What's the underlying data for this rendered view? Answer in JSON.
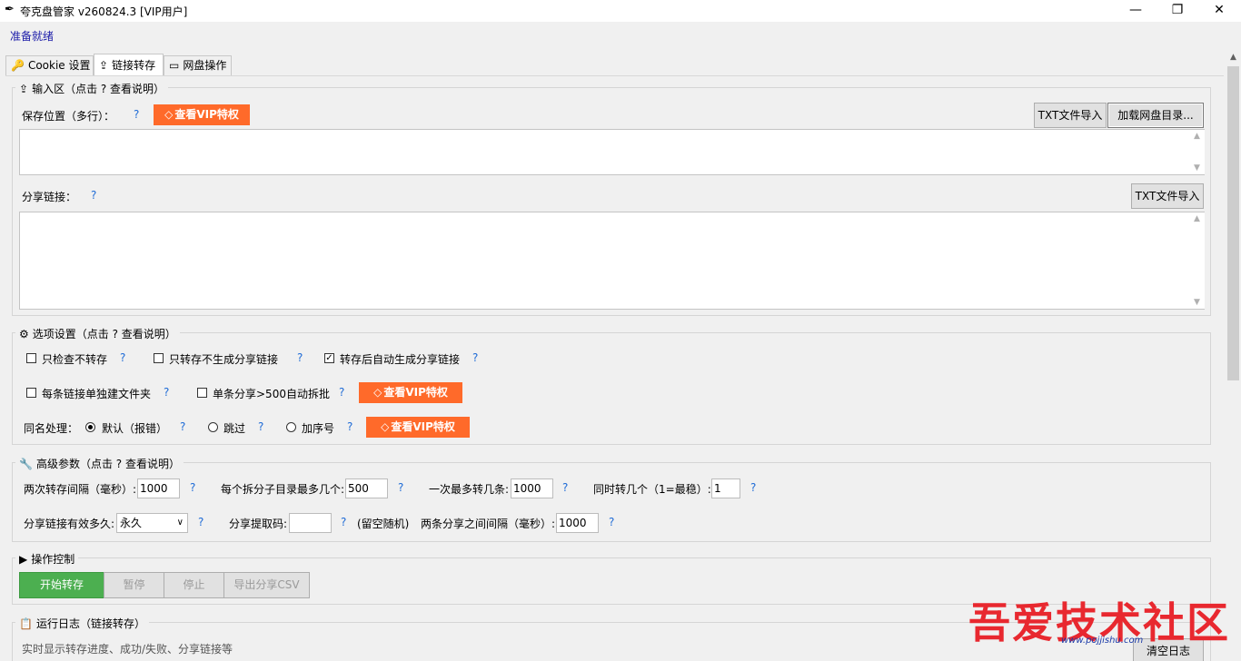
{
  "window": {
    "title": "夸克盘管家 v260824.3  [VIP用户]",
    "minimize_glyph": "—",
    "maximize_glyph": "❐",
    "close_glyph": "✕"
  },
  "status": "准备就绪",
  "tabs": [
    {
      "label": "Cookie 设置",
      "icon": "key-icon"
    },
    {
      "label": "链接转存",
      "icon": "cloud-upload-icon"
    },
    {
      "label": "网盘操作",
      "icon": "folder-icon"
    }
  ],
  "input_section": {
    "legend": "输入区（点击 ? 查看说明）",
    "save_location_label": "保存位置（多行）：",
    "help": "?",
    "vip_button": "查看VIP特权",
    "txt_import": "TXT文件导入",
    "load_dir": "加载网盘目录...",
    "share_link_label": "分享链接：",
    "share_txt_import": "TXT文件导入"
  },
  "options_section": {
    "legend": "选项设置（点击 ? 查看说明）",
    "only_check": {
      "label": "只检查不转存",
      "checked": false
    },
    "only_save": {
      "label": "只转存不生成分享链接",
      "checked": false
    },
    "auto_share": {
      "label": "转存后自动生成分享链接",
      "checked": true
    },
    "per_link_folder": {
      "label": "每条链接单独建文件夹",
      "checked": false
    },
    "auto_split": {
      "label": "单条分享>500自动拆批",
      "checked": false
    },
    "vip_button": "查看VIP特权",
    "same_name_label": "同名处理：",
    "radio_default": {
      "label": "默认（报错）",
      "selected": true
    },
    "radio_skip": {
      "label": "跳过",
      "selected": false
    },
    "radio_seq": {
      "label": "加序号",
      "selected": false
    },
    "vip_button2": "查看VIP特权",
    "check_glyph": "✓",
    "help": "?"
  },
  "advanced_section": {
    "legend": "高级参数（点击 ? 查看说明）",
    "interval_label": "两次转存间隔（毫秒）:",
    "interval_value": "1000",
    "max_subdir_label": "每个拆分子目录最多几个:",
    "max_subdir_value": "500",
    "max_per_label": "一次最多转几条:",
    "max_per_value": "1000",
    "concurrency_label": "同时转几个（1=最稳）:",
    "concurrency_value": "1",
    "validity_label": "分享链接有效多久:",
    "validity_value": "永久",
    "code_label": "分享提取码:",
    "code_value": "",
    "code_hint": "(留空随机)",
    "share_interval_label": "两条分享之间间隔（毫秒）:",
    "share_interval_value": "1000",
    "help": "?"
  },
  "control_section": {
    "legend": "操作控制",
    "start": "开始转存",
    "pause": "暂停",
    "stop": "停止",
    "export": "导出分享CSV"
  },
  "log_section": {
    "legend": "运行日志（链接转存）",
    "placeholder": "实时显示转存进度、成功/失败、分享链接等",
    "clear": "清空日志"
  },
  "watermark": {
    "text": "吾爱技术社区",
    "url": "www.pojjishu.com"
  },
  "colors": {
    "vip": "#ff6a2a",
    "start_button": "#4caf50",
    "help_mark": "#1e6bd6",
    "status_text": "#1a1aa8"
  }
}
